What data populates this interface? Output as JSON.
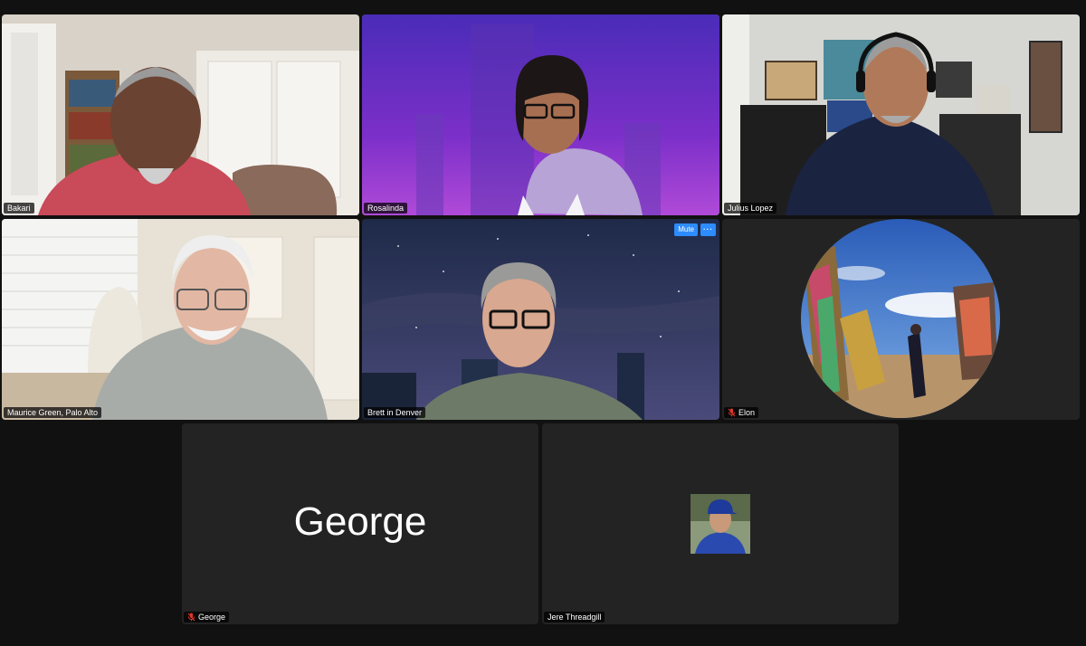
{
  "app": {
    "colors": {
      "background": "#111111",
      "tile": "#232323",
      "active_speaker": "#3ccf5a",
      "button": "#2d8cff",
      "muted_mic": "#e0362c"
    }
  },
  "participants": [
    {
      "id": "bakari",
      "name": "Bakari",
      "video": true,
      "muted": false,
      "active": false
    },
    {
      "id": "rosalinda",
      "name": "Rosalinda",
      "video": true,
      "muted": false,
      "active": true
    },
    {
      "id": "julius",
      "name": "Julius Lopez",
      "video": true,
      "muted": false,
      "active": false
    },
    {
      "id": "maurice",
      "name": "Maurice Green, Palo Alto",
      "video": true,
      "muted": false,
      "active": false
    },
    {
      "id": "brett",
      "name": "Brett in Denver",
      "video": true,
      "muted": false,
      "active": false,
      "controls": {
        "mute_label": "Mute",
        "more_label": "···"
      }
    },
    {
      "id": "elon",
      "name": "Elon",
      "video": false,
      "muted": true,
      "active": false,
      "display": "profile-photo"
    },
    {
      "id": "george",
      "name": "George",
      "video": false,
      "muted": true,
      "active": false,
      "display": "name-text",
      "big_name": "George"
    },
    {
      "id": "jere",
      "name": "Jere Threadgill",
      "video": false,
      "muted": false,
      "active": false,
      "display": "small-avatar"
    }
  ]
}
